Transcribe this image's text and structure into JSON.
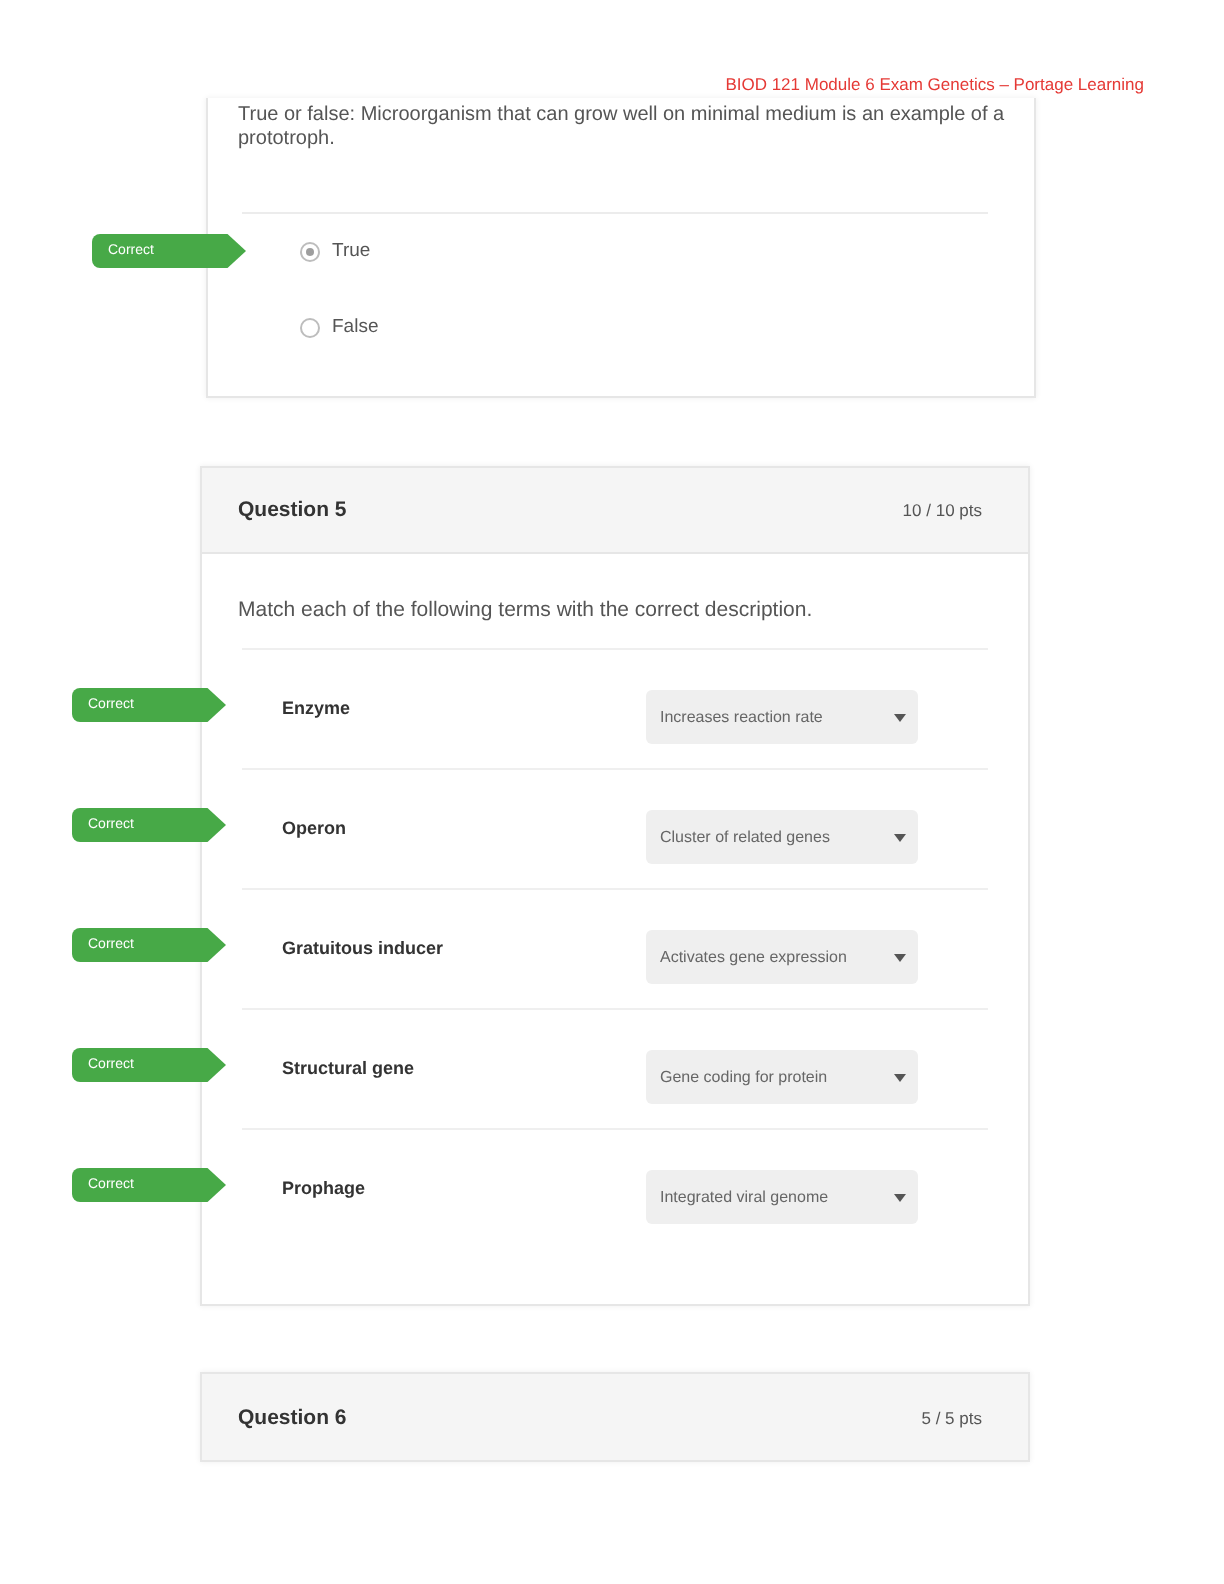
{
  "document_header": "BIOD 121 Module 6 Exam Genetics – Portage Learning",
  "questions": [
    {
      "kind": "true_false",
      "prompt": "True or false: Microorganism that can grow well on minimal medium is an example of a prototroph.",
      "answers": [
        {
          "label": "True",
          "selected": true,
          "result": "Correct"
        },
        {
          "label": "False",
          "selected": false
        }
      ]
    },
    {
      "kind": "matching",
      "title": "Question 5",
      "points": "10 / 10 pts",
      "prompt": "Match each of the following terms with the correct description.",
      "pairs": [
        {
          "term": "Enzyme",
          "answer": "Increases reaction rate",
          "result": "Correct"
        },
        {
          "term": "Operon",
          "answer": "Cluster of related genes",
          "result": "Correct"
        },
        {
          "term": "Gratuitous inducer",
          "answer": "Activates gene expression",
          "result": "Correct"
        },
        {
          "term": "Structural gene",
          "answer": "Gene coding for protein",
          "result": "Correct"
        },
        {
          "term": "Prophage",
          "answer": "Integrated viral genome",
          "result": "Correct"
        }
      ]
    },
    {
      "kind": "heading",
      "title": "Question 6",
      "points": "5 / 5 pts"
    }
  ]
}
